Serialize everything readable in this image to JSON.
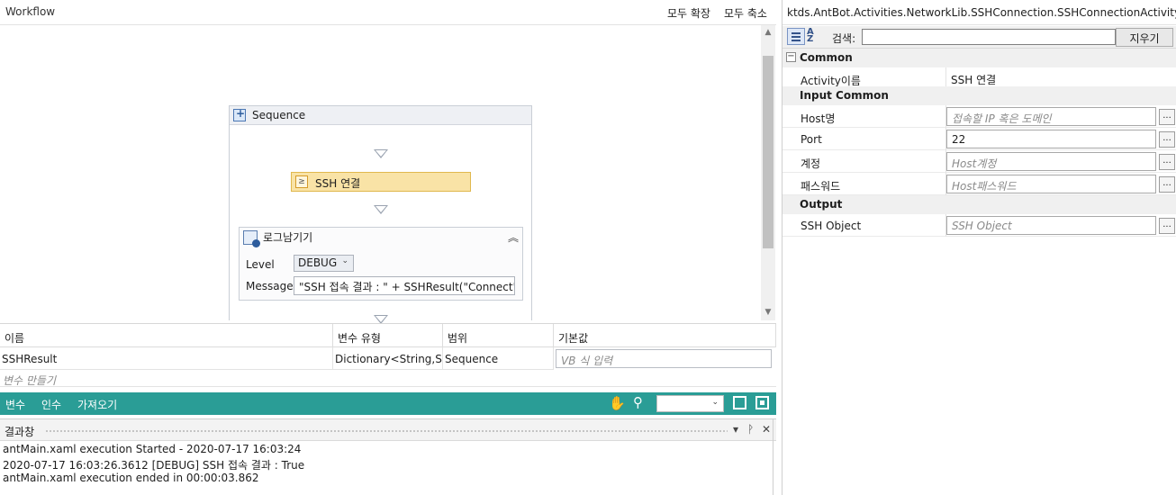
{
  "designer": {
    "title": "Workflow",
    "expand_all": "모두 확장",
    "collapse_all": "모두 축소"
  },
  "sequence": {
    "title": "Sequence",
    "ssh_activity": "SSH 연결",
    "log_activity": {
      "title": "로그남기기",
      "level_label": "Level",
      "level_value": "DEBUG",
      "message_label": "Message",
      "message_value": "\"SSH 접속 결과 : \" + SSHResult(\"Connect\")"
    }
  },
  "variables": {
    "columns": [
      "이름",
      "변수 유형",
      "범위",
      "기본값"
    ],
    "rows": [
      {
        "name": "SSHResult",
        "type": "Dictionary<String,Strin",
        "scope": "Sequence",
        "default_placeholder": "VB 식 입력"
      }
    ],
    "create_hint": "변수 만들기"
  },
  "bottom_bar": {
    "tabs": [
      "변수",
      "인수",
      "가져오기"
    ],
    "accent_color": "#2a9d96",
    "icons": [
      "hand-icon",
      "magnifier-icon",
      "fit-screen-icon",
      "overview-icon"
    ]
  },
  "output": {
    "title": "결과창",
    "lines": [
      "antMain.xaml execution Started - 2020-07-17 16:03:24",
      "2020-07-17 16:03:26.3612 [DEBUG] SSH 접속 결과 : True",
      "antMain.xaml execution ended in 00:00:03.862"
    ]
  },
  "properties": {
    "title": "ktds.AntBot.Activities.NetworkLib.SSHConnection.SSHConnectionActivity",
    "search_label": "검색:",
    "clear_label": "지우기",
    "categories": [
      {
        "name": "Common",
        "rows": [
          {
            "name": "Activity이름",
            "value": "SSH 연결"
          }
        ]
      },
      {
        "name": "Input Common",
        "rows": [
          {
            "name": "Host명",
            "placeholder": "접속할 IP 혹은 도메인"
          },
          {
            "name": "Port",
            "value": "22"
          },
          {
            "name": "계정",
            "placeholder": "Host계정"
          },
          {
            "name": "패스워드",
            "placeholder": "Host패스워드"
          }
        ]
      },
      {
        "name": "Output",
        "rows": [
          {
            "name": "SSH Object",
            "placeholder": "SSH Object"
          }
        ]
      }
    ],
    "ellipsis": "..."
  }
}
